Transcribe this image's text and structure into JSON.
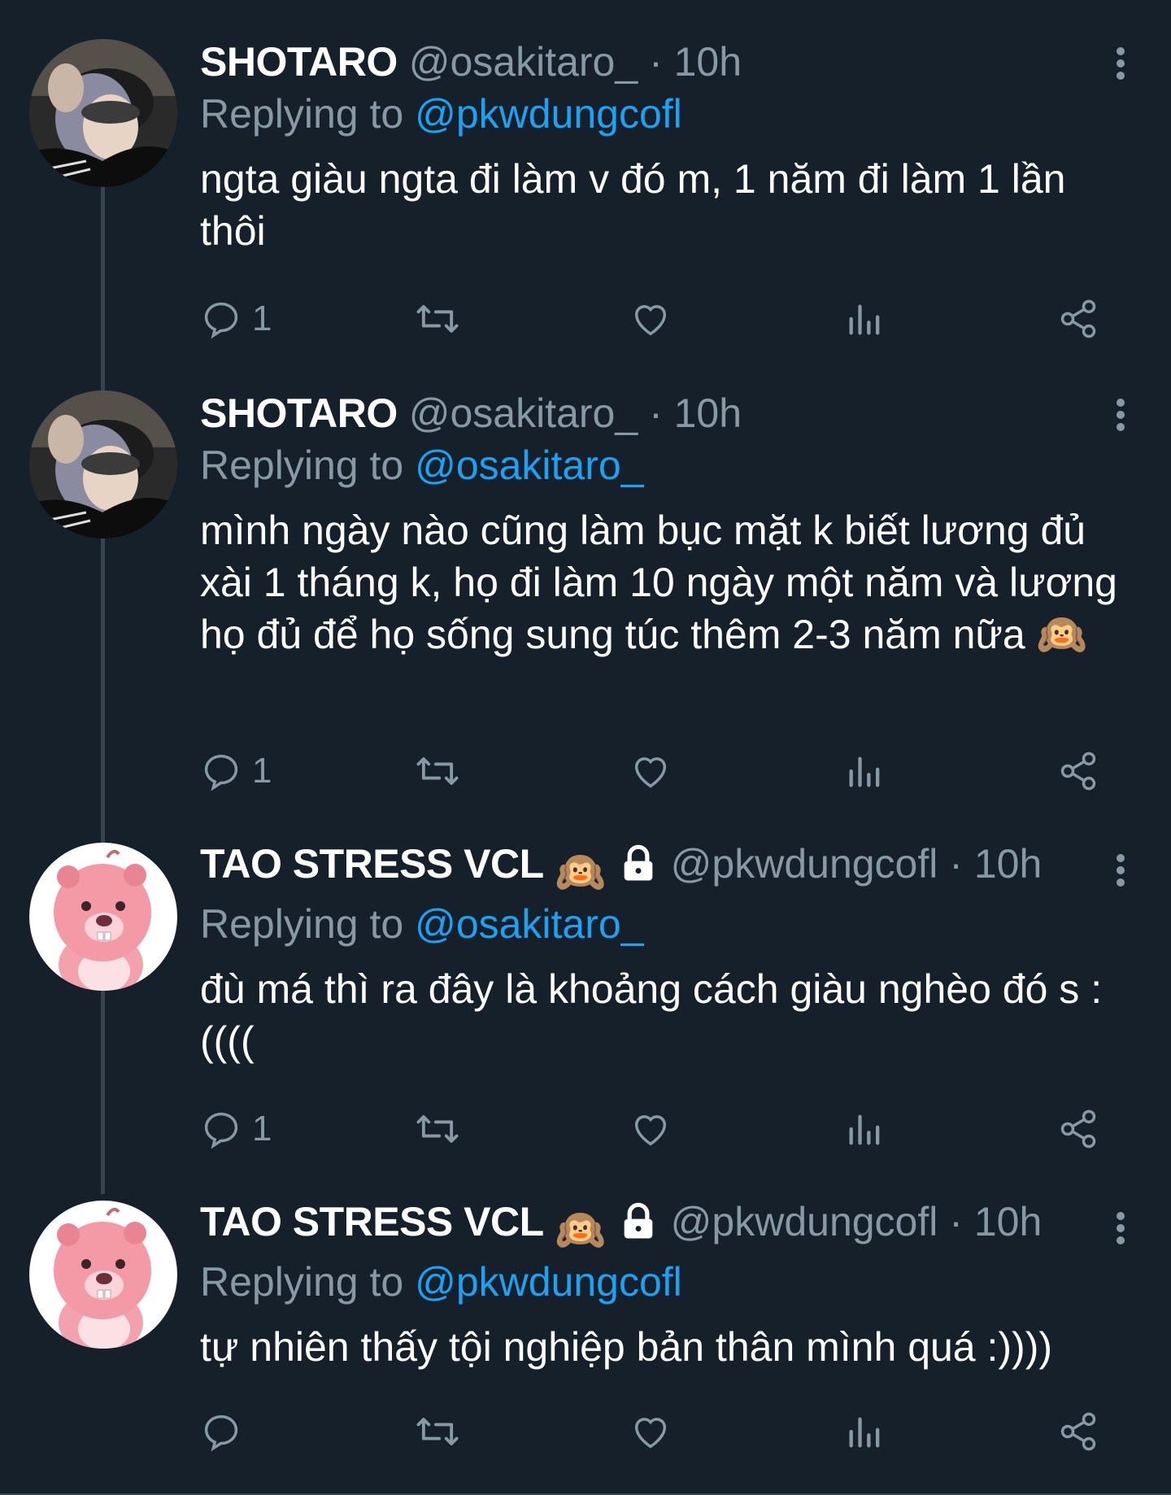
{
  "tweets": [
    {
      "name": "SHOTARO",
      "handle": "@osakitaro_",
      "time": "10h",
      "reply_prefix": "Replying to",
      "reply_to": "@pkwdungcofl",
      "text": "ngta giàu ngta đi làm v đó m, 1 năm đi làm 1 lần thôi",
      "reply_count": "1",
      "avatar": "shotaro-avatar"
    },
    {
      "name": "SHOTARO",
      "handle": "@osakitaro_",
      "time": "10h",
      "reply_prefix": "Replying to",
      "reply_to": "@osakitaro_",
      "text": "mình ngày nào cũng làm bục mặt k biết lương đủ xài 1 tháng k, họ đi làm 10 ngày một năm và lương họ đủ để họ sống sung túc thêm 2-3 năm nữa 🙉",
      "reply_count": "1",
      "avatar": "shotaro-avatar"
    },
    {
      "name": "TAO STRESS VCL",
      "name_emoji": "🙉",
      "handle": "@pkwdungcofl",
      "time": "10h",
      "reply_prefix": "Replying to",
      "reply_to": "@osakitaro_",
      "text": "đù má thì ra đây là khoảng cách giàu nghèo đó s :((((",
      "reply_count": "1",
      "avatar": "beaver-avatar"
    },
    {
      "name": "TAO STRESS VCL",
      "name_emoji": "🙉",
      "handle": "@pkwdungcofl",
      "time": "10h",
      "reply_prefix": "Replying to",
      "reply_to": "@pkwdungcofl",
      "text": "tự nhiên thấy tội nghiệp bản thân mình quá :))))",
      "reply_count": "",
      "avatar": "beaver-avatar"
    }
  ],
  "separator": "·",
  "colors": {
    "background": "#15202b",
    "secondary_text": "#8899a6",
    "mention": "#1da1f2",
    "thread_line": "#38444d"
  },
  "icons": [
    "reply-icon",
    "retweet-icon",
    "like-icon",
    "analytics-icon",
    "share-icon",
    "more-icon",
    "lock-icon"
  ]
}
